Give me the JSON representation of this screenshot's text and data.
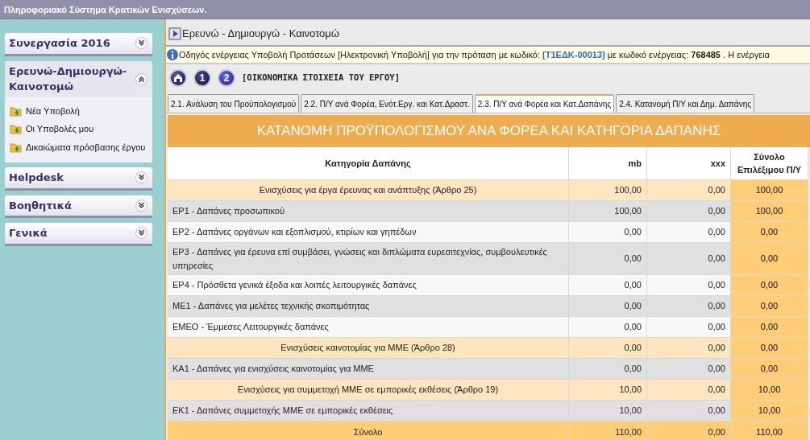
{
  "header": {
    "title": "Πληροφοριακό Σύστημα Κρατικών Ενισχύσεων."
  },
  "sidebar": {
    "panels": [
      {
        "title": "Συνεργασία 2016",
        "expanded": false
      },
      {
        "title": "Ερευνώ-Δημιουργώ-Καινοτομώ",
        "expanded": true,
        "items": [
          "Νέα Υποβολή",
          "Οι Υποβολές μου",
          "Δικαιώματα πρόσβασης έργου"
        ]
      },
      {
        "title": "Helpdesk",
        "expanded": false
      },
      {
        "title": "Βοηθητικά",
        "expanded": false
      },
      {
        "title": "Γενικά",
        "expanded": false
      }
    ]
  },
  "page_title": "Ερευνώ - Δημιουργώ - Καινοτομώ",
  "info": [
    {
      "kind": "plain",
      "text": "Οδηγός ενέργειας Υποβολή Προτάσεων [Ηλεκτρονική Υποβολή] για την πρόταση με κωδικό: "
    },
    {
      "kind": "code",
      "text": "[Τ1ΕΔΚ-00013]"
    },
    {
      "kind": "plain",
      "text": " με κωδικό ενέργειας: "
    },
    {
      "kind": "bold",
      "text": "768485"
    },
    {
      "kind": "plain",
      "text": " . Η ενέργεια"
    }
  ],
  "steps": [
    {
      "kind": "home"
    },
    {
      "kind": "number",
      "text": "1",
      "selected": false
    },
    {
      "kind": "number",
      "text": "2",
      "selected": true
    }
  ],
  "step_title": "[ΟΙΚΟΝΟΜΙΚΑ ΣΤΟΙΧΕΙΑ ΤΟΥ ΕΡΓΟΥ]",
  "tabs": [
    {
      "label": "2.1. Ανάλυση του Προϋπολογισμού",
      "selected": false
    },
    {
      "label": "2.2. Π/Υ ανά Φορέα, Ενότ.Εργ. και Κατ.Δραστ.",
      "selected": false
    },
    {
      "label": "2.3. Π/Υ ανά Φορέα και Κατ.Δαπάνης",
      "selected": true
    },
    {
      "label": "2.4. Κατανομή Π/Υ και Δημ. Δαπάνης",
      "selected": false
    }
  ],
  "table": {
    "title": "ΚΑΤΑΝΟΜΗ ΠΡΟΫΠΟΛΟΓΙΣΜΟΥ ΑΝΑ ΦΟΡΕΑ ΚΑΙ ΚΑΤΗΓΟΡΙΑ ΔΑΠΑΝΗΣ",
    "columns": [
      "Κατηγορία Δαπάνης",
      "mb",
      "xxx",
      "Σύνολο Επιλέξιμου Π/Υ"
    ],
    "rows": [
      {
        "kind": "group",
        "cells": [
          "Ενισχύσεις για έργα έρευνας και ανάπτυξης (Άρθρο 25)",
          "100,00",
          "0,00",
          "100,00"
        ]
      },
      {
        "kind": "item",
        "cells": [
          "ΕΡ1 - Δαπάνες προσωπικού",
          "100,00",
          "0,00",
          "100,00"
        ]
      },
      {
        "kind": "item",
        "cells": [
          "ΕΡ2 - Δαπάνες οργάνων και εξοπλισμού, κτιρίων και γηπέδων",
          "0,00",
          "0,00",
          "0,00"
        ]
      },
      {
        "kind": "item",
        "cells": [
          "ΕΡ3 - Δαπάνες για έρευνα επί συμβάσει, γνώσεις και διπλώματα ευρεσιτεχνίας, συμβουλευτικές υπηρεσίες",
          "0,00",
          "0,00",
          "0,00"
        ]
      },
      {
        "kind": "item",
        "cells": [
          "ΕΡ4 - Πρόσθετα γενικά έξοδα και λοιπές λειτουργικές δαπάνες",
          "0,00",
          "0,00",
          "0,00"
        ]
      },
      {
        "kind": "item",
        "cells": [
          "ΜΕ1 - Δαπάνες για μελέτες τεχνικής σκοπιμότητας",
          "0,00",
          "0,00",
          "0,00"
        ]
      },
      {
        "kind": "item",
        "cells": [
          "ΕΜΕΟ - Έμμεσες Λειτουργικές δαπάνες",
          "0,00",
          "0,00",
          "0,00"
        ]
      },
      {
        "kind": "group",
        "cells": [
          "Ενισχύσεις καινοτομίας για ΜΜΕ (Άρθρο 28)",
          "0,00",
          "0,00",
          "0,00"
        ]
      },
      {
        "kind": "item",
        "cells": [
          "ΚΑ1 - Δαπάνες για ενισχύσεις καινοτομίας για ΜΜΕ",
          "0,00",
          "0,00",
          "0,00"
        ]
      },
      {
        "kind": "group",
        "cells": [
          "Ενισχύσεις για συμμετοχή ΜΜΕ σε εμπορικές εκθέσεις (Άρθρο 19)",
          "10,00",
          "0,00",
          "10,00"
        ]
      },
      {
        "kind": "item",
        "cells": [
          "ΕΚ1 - Δαπάνες συμμετοχής ΜΜΕ σε εμπορικές εκθέσεις",
          "10,00",
          "0,00",
          "10,00"
        ]
      },
      {
        "kind": "total",
        "cells": [
          "Σύνολο",
          "110,00",
          "0,00",
          "110,00"
        ]
      }
    ]
  }
}
